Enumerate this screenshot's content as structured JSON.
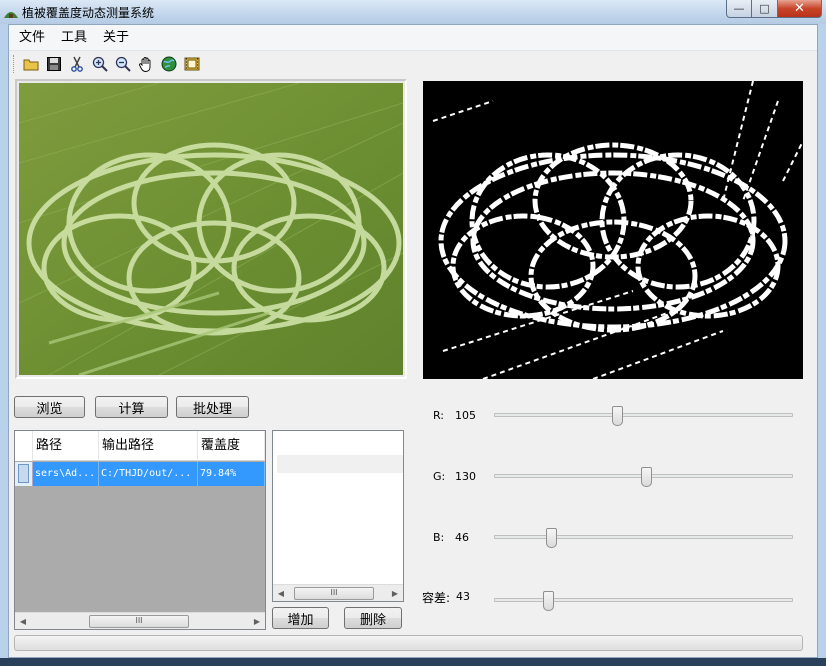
{
  "window": {
    "title": "植被覆盖度动态测量系统"
  },
  "menu": {
    "items": [
      "文件",
      "工具",
      "关于"
    ]
  },
  "toolbar": {
    "icons": [
      "open-folder-icon",
      "save-icon",
      "cut-icon",
      "zoom-in-icon",
      "zoom-out-icon",
      "hand-pan-icon",
      "globe-icon",
      "film-icon"
    ]
  },
  "buttons": {
    "browse": "浏览",
    "compute": "计算",
    "batch": "批处理",
    "add": "增加",
    "delete": "删除"
  },
  "grid": {
    "headers": [
      "路径",
      "输出路径",
      "覆盖度"
    ],
    "row": {
      "path": "sers\\Ad...",
      "output": "C:/THJD/out/...",
      "coverage": "79.84%"
    },
    "scroll_grip": "III"
  },
  "list": {
    "scroll_grip": "III"
  },
  "sliders": [
    {
      "label": "R:",
      "value": "105",
      "level": 0.41
    },
    {
      "label": "G:",
      "value": "130",
      "level": 0.51
    },
    {
      "label": "B:",
      "value": "46",
      "level": 0.18
    },
    {
      "label": "容差:",
      "value": "43",
      "level": 0.17
    }
  ]
}
